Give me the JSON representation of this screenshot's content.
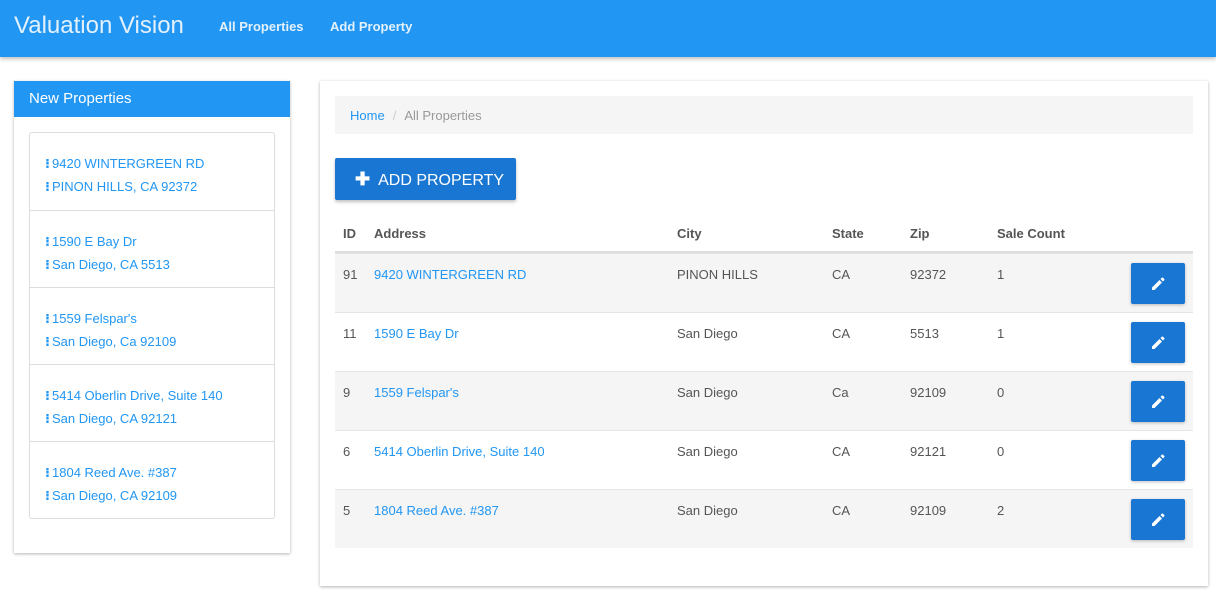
{
  "navbar": {
    "brand": "Valuation Vision",
    "links": [
      "All Properties",
      "Add Property"
    ]
  },
  "sidebar": {
    "title": "New Properties",
    "items": [
      {
        "street": "9420 WINTERGREEN RD",
        "city_line": "PINON HILLS, CA 92372"
      },
      {
        "street": "1590 E Bay Dr",
        "city_line": "San Diego, CA 5513"
      },
      {
        "street": "1559 Felspar's",
        "city_line": "San Diego, Ca 92109"
      },
      {
        "street": "5414 Oberlin Drive, Suite 140",
        "city_line": "San Diego, CA 92121"
      },
      {
        "street": "1804 Reed Ave. #387",
        "city_line": "San Diego, CA 92109"
      }
    ]
  },
  "breadcrumb": {
    "home": "Home",
    "separator": "/",
    "current": "All Properties"
  },
  "add_button": {
    "label": "ADD PROPERTY",
    "icon": "plus-icon"
  },
  "table": {
    "headers": [
      "ID",
      "Address",
      "City",
      "State",
      "Zip",
      "Sale Count"
    ],
    "rows": [
      {
        "id": "91",
        "address": "9420 WINTERGREEN RD",
        "city": "PINON HILLS",
        "state": "CA",
        "zip": "92372",
        "sale_count": "1"
      },
      {
        "id": "11",
        "address": "1590 E Bay Dr",
        "city": "San Diego",
        "state": "CA",
        "zip": "5513",
        "sale_count": "1"
      },
      {
        "id": "9",
        "address": "1559 Felspar's",
        "city": "San Diego",
        "state": "Ca",
        "zip": "92109",
        "sale_count": "0"
      },
      {
        "id": "6",
        "address": "5414 Oberlin Drive, Suite 140",
        "city": "San Diego",
        "state": "CA",
        "zip": "92121",
        "sale_count": "0"
      },
      {
        "id": "5",
        "address": "1804 Reed Ave. #387",
        "city": "San Diego",
        "state": "CA",
        "zip": "92109",
        "sale_count": "2"
      }
    ],
    "row_action_icon": "pencil-icon"
  },
  "colors": {
    "primary": "#2196f3",
    "button": "#1976d2"
  }
}
